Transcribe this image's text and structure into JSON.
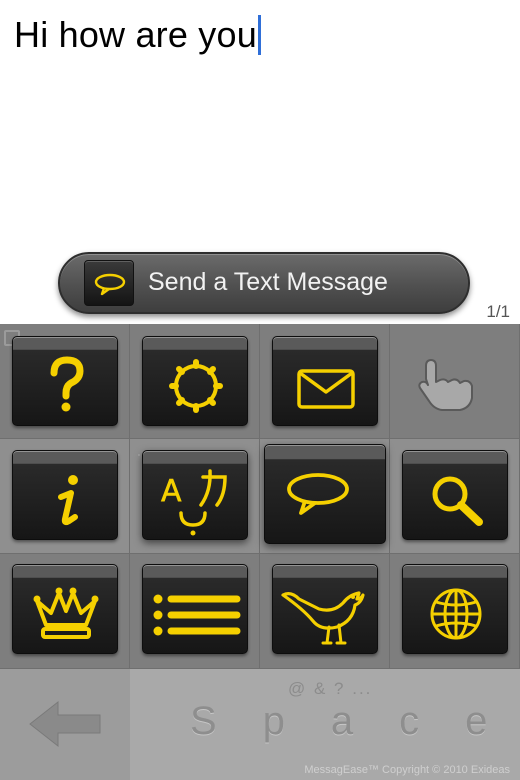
{
  "editor": {
    "text": "Hi how are you"
  },
  "suggestion": {
    "label": "Send a Text Message",
    "icon": "speech-bubble-icon"
  },
  "page_indicator": "1/1",
  "keyboard": {
    "accent_color": "#f5d000",
    "keys": [
      {
        "name": "help-key",
        "icon": "question-mark-icon"
      },
      {
        "name": "settings-key",
        "icon": "gear-icon"
      },
      {
        "name": "email-key",
        "icon": "envelope-icon"
      },
      {
        "name": "info-key",
        "icon": "info-icon"
      },
      {
        "name": "translate-key",
        "icon": "translate-icon"
      },
      {
        "name": "text-message-key",
        "icon": "speech-bubble-icon"
      },
      {
        "name": "search-key",
        "icon": "magnifier-icon"
      },
      {
        "name": "favorites-key",
        "icon": "crown-icon"
      },
      {
        "name": "list-key",
        "icon": "list-icon"
      },
      {
        "name": "twitter-key",
        "icon": "bird-icon"
      },
      {
        "name": "web-key",
        "icon": "globe-icon"
      }
    ],
    "space": {
      "hint": "@ & ? ...",
      "label": "Space"
    },
    "copyright": "MessagEase™ Copyright © 2010 Exideas"
  }
}
